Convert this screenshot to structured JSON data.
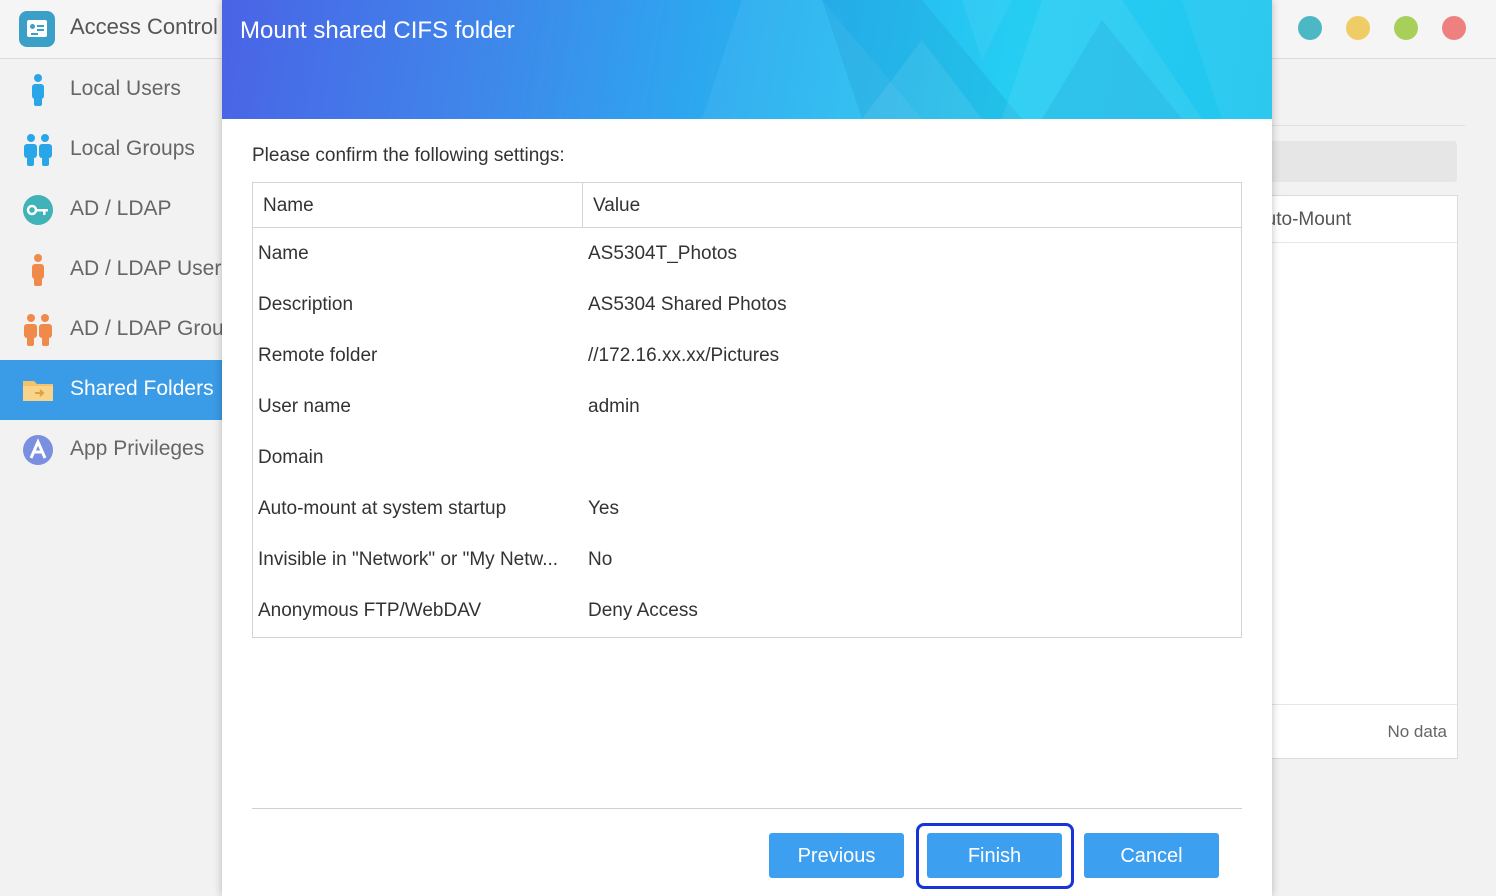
{
  "app": {
    "title": "Access Control",
    "window_buttons": [
      {
        "name": "teal",
        "color": "#4cb8c4"
      },
      {
        "name": "yellow",
        "color": "#f0cc66"
      },
      {
        "name": "green",
        "color": "#a8cf5a"
      },
      {
        "name": "red",
        "color": "#ef8080"
      }
    ]
  },
  "sidebar": {
    "items": [
      {
        "label": "Local Users",
        "icon": "user-icon",
        "active": false
      },
      {
        "label": "Local Groups",
        "icon": "group-icon",
        "active": false
      },
      {
        "label": "AD / LDAP",
        "icon": "key-icon",
        "active": false
      },
      {
        "label": "AD / LDAP Users",
        "icon": "ad-user-icon",
        "active": false
      },
      {
        "label": "AD / LDAP Groups",
        "icon": "ad-group-icon",
        "active": false
      },
      {
        "label": "Shared Folders",
        "icon": "folder-icon",
        "active": true
      },
      {
        "label": "App Privileges",
        "icon": "app-privileges-icon",
        "active": false
      }
    ]
  },
  "background": {
    "column_header": "Auto-Mount",
    "no_data": "No data"
  },
  "dialog": {
    "title": "Mount shared CIFS folder",
    "prompt": "Please confirm the following settings:",
    "columns": [
      "Name",
      "Value"
    ],
    "rows": [
      {
        "name": "Name",
        "value": "AS5304T_Photos"
      },
      {
        "name": "Description",
        "value": "AS5304 Shared Photos"
      },
      {
        "name": "Remote folder",
        "value": "//172.16.xx.xx/Pictures"
      },
      {
        "name": "User name",
        "value": "admin"
      },
      {
        "name": "Domain",
        "value": ""
      },
      {
        "name": "Auto-mount at system startup",
        "value": "Yes"
      },
      {
        "name": "Invisible in \"Network\" or \"My Netw...",
        "value": "No"
      },
      {
        "name": "Anonymous FTP/WebDAV",
        "value": "Deny Access"
      }
    ],
    "buttons": {
      "previous": "Previous",
      "finish": "Finish",
      "cancel": "Cancel"
    }
  }
}
